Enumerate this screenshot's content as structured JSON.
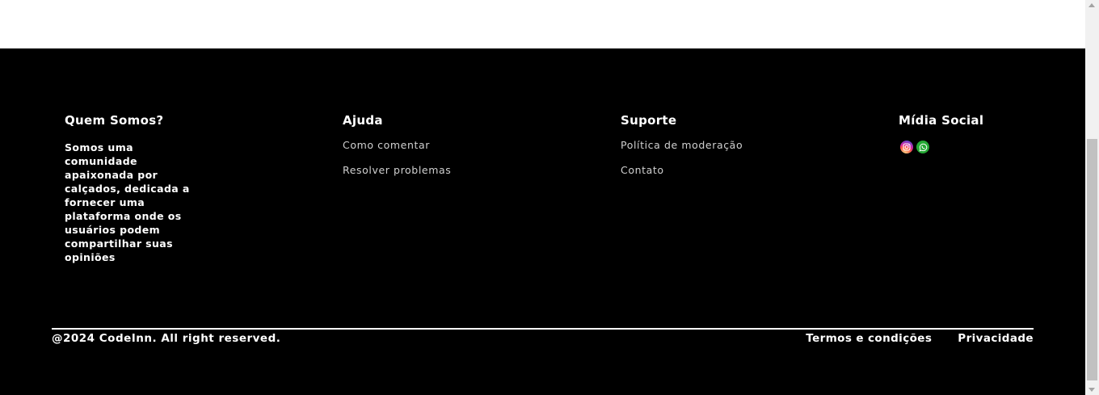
{
  "footer": {
    "about": {
      "heading": "Quem Somos?",
      "text": "Somos uma comunidade apaixonada por calçados, dedicada a fornecer uma plataforma onde os usuários podem compartilhar suas opiniões"
    },
    "help": {
      "heading": "Ajuda",
      "links": [
        "Como comentar",
        "Resolver problemas"
      ]
    },
    "support": {
      "heading": "Suporte",
      "links": [
        "Política de moderação",
        "Contato"
      ]
    },
    "social": {
      "heading": "Mídia Social",
      "icons": [
        "instagram-icon",
        "whatsapp-icon"
      ]
    },
    "copyright": "@2024 CodeInn. All right reserved.",
    "bottom_links": [
      "Termos e condições",
      "Privacidade"
    ]
  },
  "colors": {
    "footer_bg": "#000000",
    "page_bg": "#ffffff",
    "link_text": "#d0d0d0",
    "whatsapp": "#25a935"
  }
}
